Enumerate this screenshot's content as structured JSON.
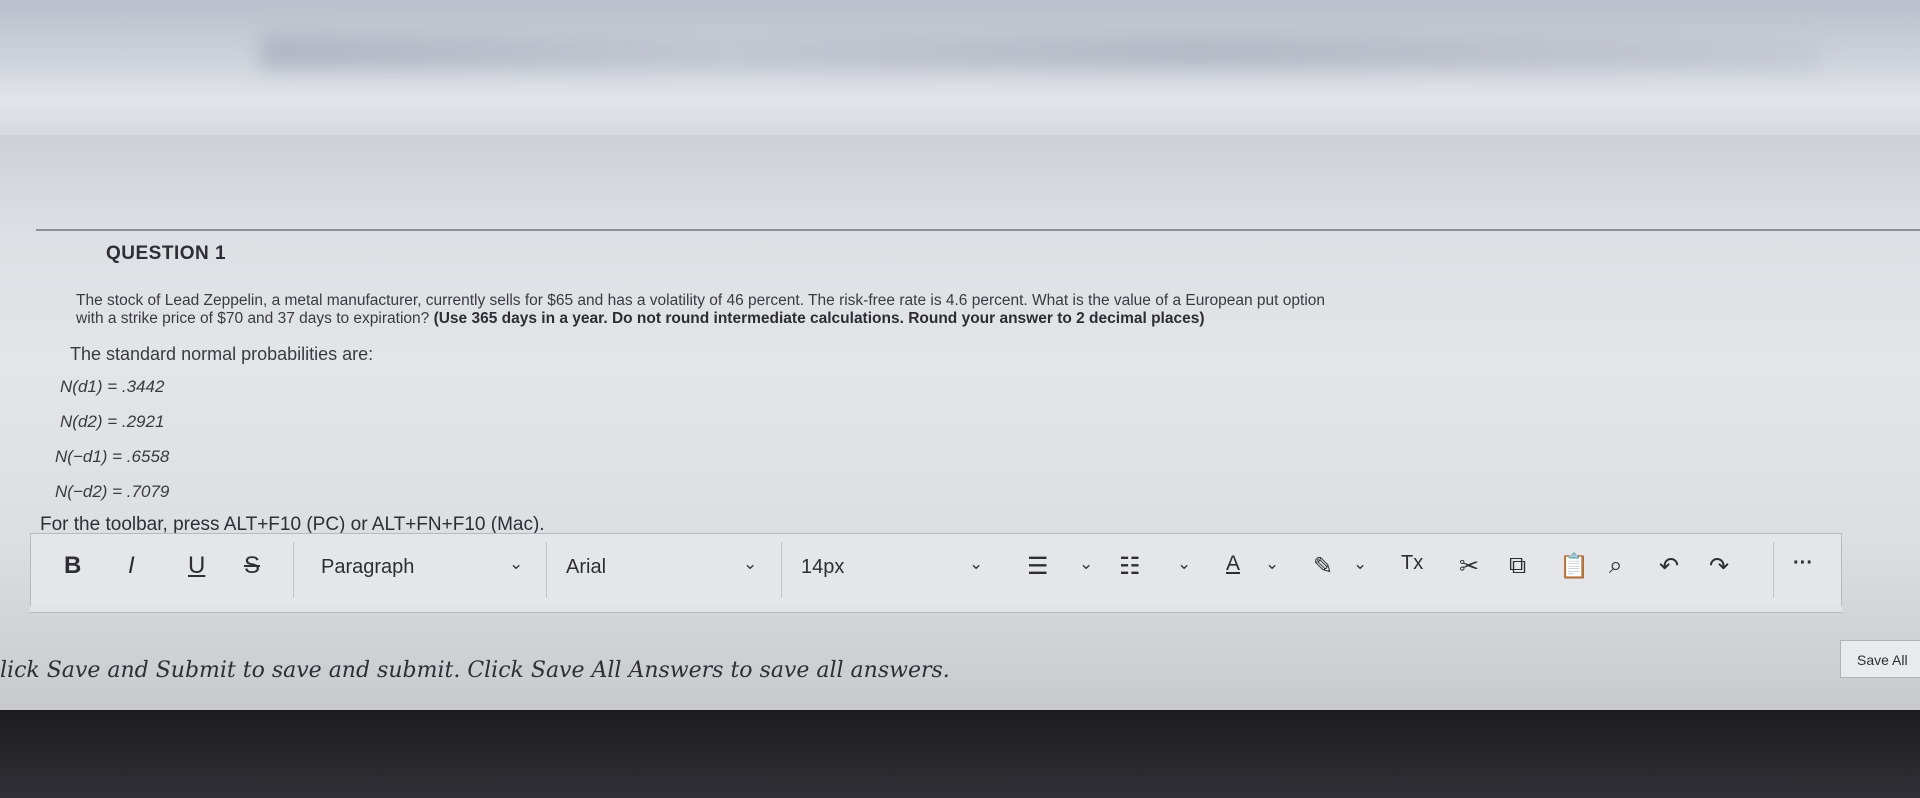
{
  "question": {
    "title": "QUESTION 1",
    "body_line1": "The stock of Lead Zeppelin, a metal manufacturer, currently sells for $65 and has a volatility of 46 percent. The risk-free rate is 4.6 percent. What is the value of a European put option",
    "body_line2_normal": "with a strike price of $70 and 37 days to expiration? ",
    "body_line2_bold": "(Use 365 days in a year. Do not round intermediate calculations. Round your answer to 2 decimal places)",
    "intro": "The standard normal probabilities are:",
    "probabilities": [
      {
        "label": "N(d1) = .3442"
      },
      {
        "label": "N(d2) = .2921"
      },
      {
        "label": "N(−d1) = .6558"
      },
      {
        "label": "N(−d2) = .7079"
      }
    ]
  },
  "toolbar": {
    "hint": "For the toolbar, press ALT+F10 (PC) or ALT+FN+F10 (Mac).",
    "bold": "B",
    "italic": "I",
    "underline": "U",
    "strikethrough": "S",
    "paragraph": "Paragraph",
    "font": "Arial",
    "size": "14px",
    "chevron": "⌄",
    "icons": {
      "bullet_list": "☰",
      "numbered_list": "☷",
      "text_color": "A",
      "highlight": "✎",
      "clear_format": "Tx",
      "cut": "✂",
      "copy": "⧉",
      "paste": "📋",
      "find": "⌕",
      "undo": "↶",
      "redo": "↷",
      "more": "···"
    }
  },
  "footer": {
    "note": "lick Save and Submit to save and submit. Click Save All Answers to save all answers.",
    "save_all_label": "Save All"
  }
}
